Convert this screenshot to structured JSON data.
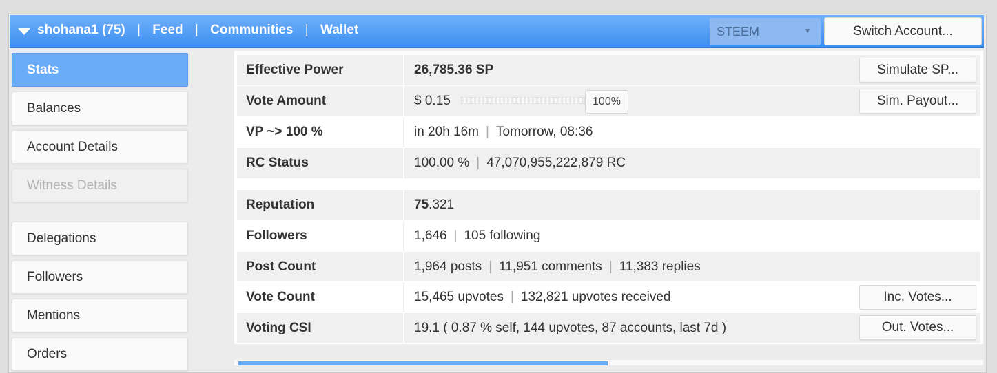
{
  "header": {
    "account": "shohana1 (75)",
    "sep": "|",
    "nav": [
      "Feed",
      "Communities",
      "Wallet"
    ],
    "chain_select": "STEEM",
    "switch_button": "Switch Account..."
  },
  "sidebar": {
    "items": [
      {
        "label": "Stats",
        "state": "active"
      },
      {
        "label": "Balances",
        "state": "normal"
      },
      {
        "label": "Account Details",
        "state": "normal"
      },
      {
        "label": "Witness Details",
        "state": "disabled"
      },
      {
        "label": "Delegations",
        "state": "normal"
      },
      {
        "label": "Followers",
        "state": "normal"
      },
      {
        "label": "Mentions",
        "state": "normal"
      },
      {
        "label": "Orders",
        "state": "normal"
      }
    ]
  },
  "stats": {
    "effective_power": {
      "label": "Effective Power",
      "value": "26,785.36 SP",
      "button": "Simulate SP..."
    },
    "vote_amount": {
      "label": "Vote Amount",
      "value": "$ 0.15",
      "slider_value": "100%",
      "slider_percent": 100,
      "button": "Sim. Payout..."
    },
    "vp": {
      "label": "VP ~> 100 %",
      "value_a": "in 20h 16m",
      "value_b": "Tomorrow, 08:36"
    },
    "rc": {
      "label": "RC Status",
      "value_a": "100.00 %",
      "value_b": "47,070,955,222,879 RC"
    },
    "reputation": {
      "label": "Reputation",
      "value_int": "75",
      "value_frac": ".321"
    },
    "followers": {
      "label": "Followers",
      "value_a": "1,646",
      "value_b": "105 following"
    },
    "post_count": {
      "label": "Post Count",
      "value_a": "1,964 posts",
      "value_b": "11,951 comments",
      "value_c": "11,383 replies"
    },
    "vote_count": {
      "label": "Vote Count",
      "value_a": "15,465 upvotes",
      "value_b": "132,821 upvotes received",
      "button": "Inc. Votes..."
    },
    "voting_csi": {
      "label": "Voting CSI",
      "value": "19.1 ( 0.87 % self, 144 upvotes, 87 accounts, last 7d )",
      "button": "Out. Votes..."
    }
  }
}
